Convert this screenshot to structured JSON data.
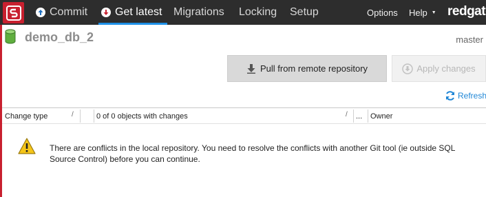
{
  "nav": {
    "tabs": [
      {
        "label": "Commit"
      },
      {
        "label": "Get latest"
      },
      {
        "label": "Migrations"
      },
      {
        "label": "Locking"
      },
      {
        "label": "Setup"
      }
    ],
    "active_tab": "Get latest",
    "menu": {
      "options": "Options",
      "help": "Help"
    },
    "brand": "redgate"
  },
  "database": {
    "name": "demo_db_2",
    "branch": "master"
  },
  "actions": {
    "pull_label": "Pull from remote repository",
    "apply_label": "Apply changes",
    "refresh_label": "Refresh"
  },
  "table": {
    "columns": [
      "Change type",
      "0 of 0 objects with changes",
      "...",
      "Owner"
    ],
    "sort_glyph": "/"
  },
  "message": {
    "text": "There are conflicts in the local repository. You need to resolve the conflicts with another Git tool (ie outside SQL Source Control) before you can continue."
  },
  "colors": {
    "accent": "#1e90e6",
    "brand_red": "#c8202f",
    "topbar": "#2d2d2d",
    "warning": "#f5c518"
  }
}
